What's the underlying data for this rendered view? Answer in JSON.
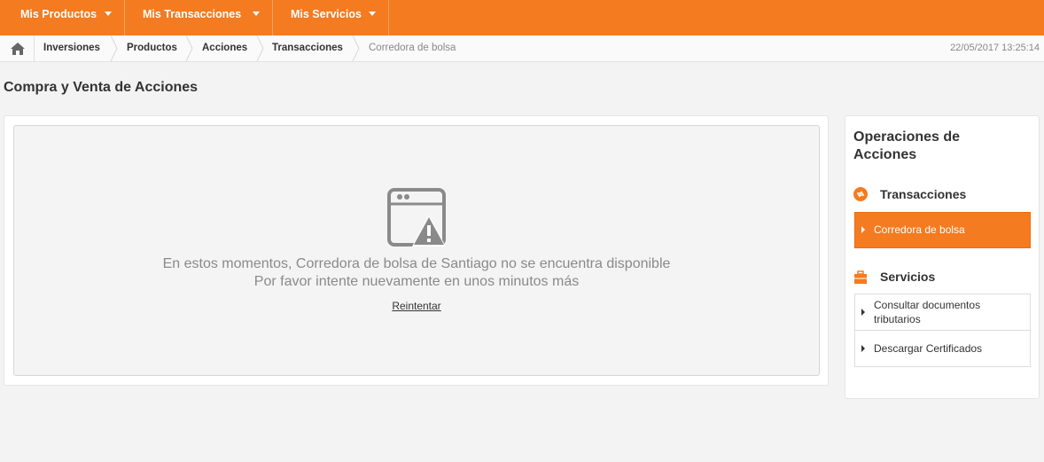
{
  "topnav": {
    "items": [
      {
        "label": "Mis Productos"
      },
      {
        "label": "Mis Transacciones"
      },
      {
        "label": "Mis Servicios"
      }
    ],
    "color": "#f47b20"
  },
  "breadcrumb": {
    "items": [
      "Inversiones",
      "Productos",
      "Acciones",
      "Transacciones"
    ],
    "current": "Corredora de bolsa",
    "datetime": "22/05/2017 13:25:14"
  },
  "page": {
    "title": "Compra y Venta de Acciones"
  },
  "error": {
    "line1": "En estos momentos, Corredora de bolsa de Santiago no se encuentra disponible",
    "line2": "Por favor intente nuevamente en unos minutos más",
    "retry_label": "Reintentar",
    "icon": "browser-warning-icon"
  },
  "sidebar": {
    "title": "Operaciones de Acciones",
    "sections": [
      {
        "label": "Transacciones",
        "icon": "exchange-icon",
        "items": [
          {
            "label": "Corredora de bolsa",
            "active": true
          }
        ]
      },
      {
        "label": "Servicios",
        "icon": "briefcase-icon",
        "items": [
          {
            "label": "Consultar documentos tributarios",
            "active": false
          },
          {
            "label": "Descargar Certificados",
            "active": false
          }
        ]
      }
    ]
  }
}
